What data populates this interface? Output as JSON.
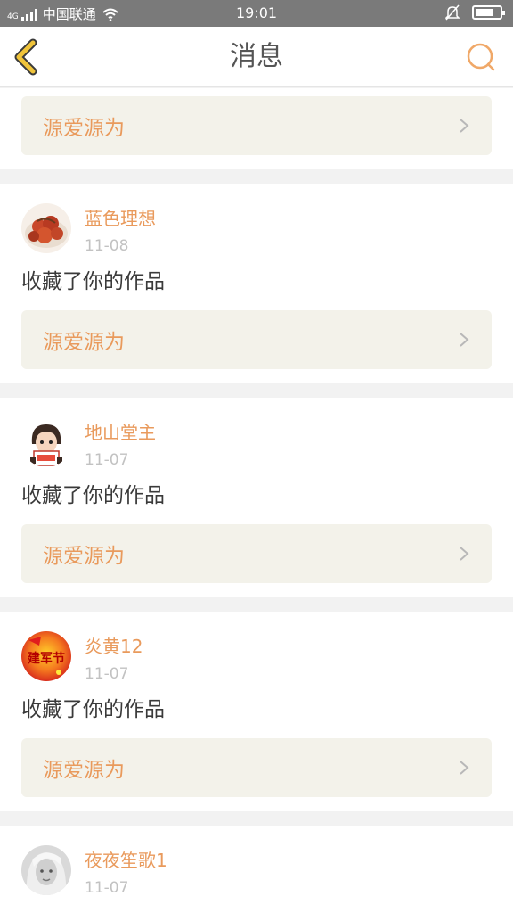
{
  "status_bar": {
    "network_type": "4G",
    "carrier": "中国联通",
    "time": "19:01"
  },
  "header": {
    "title": "消息"
  },
  "colors": {
    "accent": "#e99a5c",
    "back_icon": "#f0c43a",
    "status_bar": "#7a7a7a",
    "card_link_bg": "#f3f2ea"
  },
  "notifications": [
    {
      "work_title": "源爱源为"
    },
    {
      "username": "蓝色理想",
      "date": "11-08",
      "action": "收藏了你的作品",
      "work_title": "源爱源为"
    },
    {
      "username": "地山堂主",
      "date": "11-07",
      "action": "收藏了你的作品",
      "work_title": "源爱源为"
    },
    {
      "username": "炎黄12",
      "date": "11-07",
      "action": "收藏了你的作品",
      "work_title": "源爱源为",
      "avatar_text": "建军节"
    },
    {
      "username": "夜夜笙歌1",
      "date": "11-07"
    }
  ]
}
